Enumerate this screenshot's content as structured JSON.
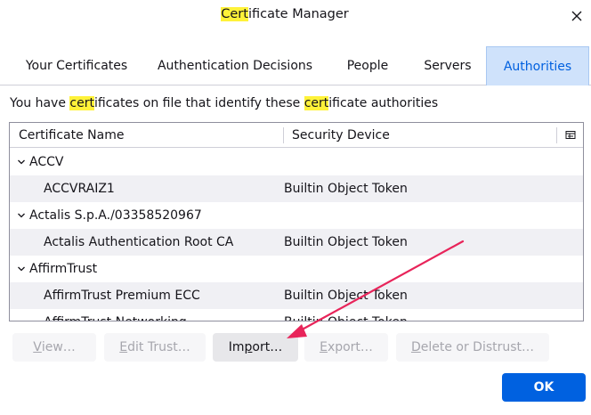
{
  "window": {
    "title_highlight": "Cert",
    "title_rest": "ificate Manager"
  },
  "tabs": [
    {
      "label": "Your Certificates"
    },
    {
      "label": "Authentication Decisions"
    },
    {
      "label": "People"
    },
    {
      "label": "Servers"
    },
    {
      "label": "Authorities",
      "selected": true
    }
  ],
  "intro": {
    "part1": "You have ",
    "hl1": "cert",
    "part2": "ificates on file that identify these ",
    "hl2": "cert",
    "part3": "ificate authorities"
  },
  "tree": {
    "columns": [
      "Certificate Name",
      "Security Device"
    ],
    "rows": [
      {
        "type": "group",
        "name": "ACCV",
        "device": ""
      },
      {
        "type": "child",
        "name": "ACCVRAIZ1",
        "device": "Builtin Object Token"
      },
      {
        "type": "group",
        "name": "Actalis S.p.A./03358520967",
        "device": ""
      },
      {
        "type": "child",
        "name": "Actalis Authentication Root CA",
        "device": "Builtin Object Token"
      },
      {
        "type": "group",
        "name": "AffirmTrust",
        "device": ""
      },
      {
        "type": "child",
        "name": "AffirmTrust Premium ECC",
        "device": "Builtin Object Token"
      },
      {
        "type": "child",
        "name": "AffirmTrust Networking",
        "device": "Builtin Object Token"
      }
    ]
  },
  "buttons": {
    "view": {
      "pre": "",
      "key": "V",
      "post": "iew…"
    },
    "edit_trust": {
      "pre": "",
      "key": "E",
      "post": "dit Trust…"
    },
    "import": {
      "pre": "Im",
      "key": "p",
      "post": "ort…"
    },
    "export": {
      "pre": "",
      "key": "E",
      "post": "xport…"
    },
    "delete": {
      "pre": "",
      "key": "D",
      "post": "elete or Distrust…"
    },
    "ok": "OK"
  },
  "colors": {
    "accent": "#0061e0",
    "selected_tab_bg": "#cfe2fb",
    "highlight": "#fff239",
    "annotation_arrow": "#e8245a"
  }
}
